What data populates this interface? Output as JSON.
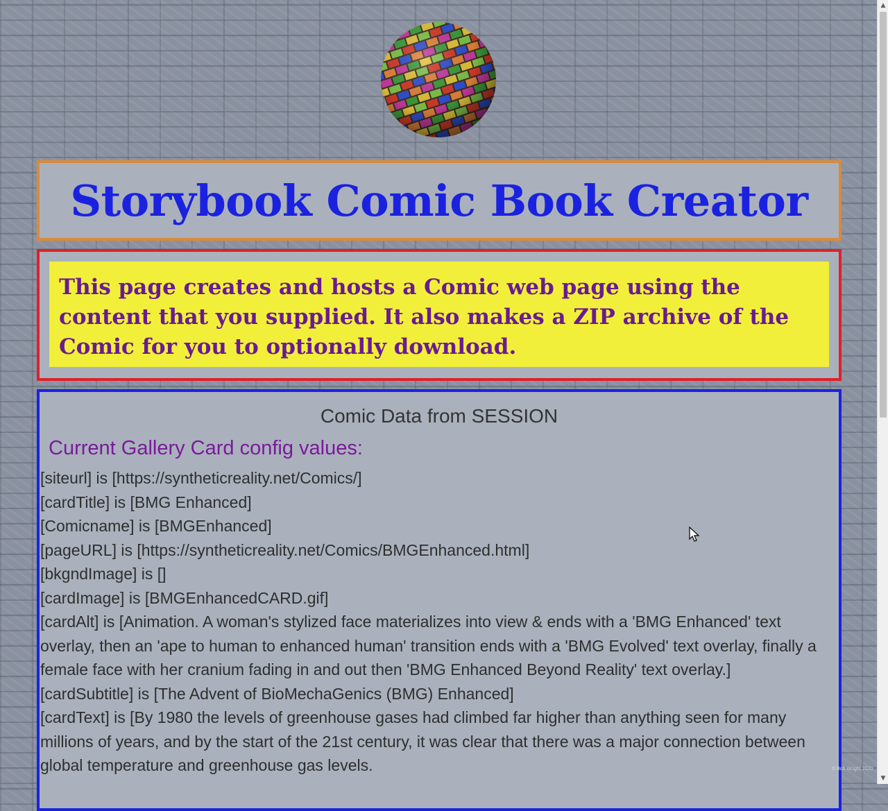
{
  "header": {
    "logo_icon": "checkered-sphere-icon",
    "title": "Storybook Comic Book Creator"
  },
  "intro": {
    "text": "This page creates and hosts a Comic web page using the content that you supplied. It also makes a ZIP archive of the Comic for you to optionally download."
  },
  "session": {
    "heading": "Comic Data from SESSION",
    "subheading": "Current Gallery Card config values:",
    "lines": [
      "[siteurl] is [https://syntheticreality.net/Comics/]",
      "[cardTitle] is [BMG Enhanced]",
      "[Comicname] is [BMGEnhanced]",
      "[pageURL] is [https://syntheticreality.net/Comics/BMGEnhanced.html]",
      "[bkgndImage] is []",
      "[cardImage] is [BMGEnhancedCARD.gif]",
      "[cardAlt] is [Animation. A woman's stylized face materializes into view & ends with a 'BMG Enhanced' text overlay, then an 'ape to human to enhanced human' transition ends with a 'BMG Evolved' text overlay, finally a female face with her cranium fading in and out then 'BMG Enhanced Beyond Reality' text overlay.]",
      "[cardSubtitle] is [The Advent of BioMechaGenics (BMG) Enhanced]",
      "[cardText] is [By 1980 the levels of greenhouse gases had climbed far higher than anything seen for many millions of years, and by the start of the 21st century, it was clear that there was a major connection between global temperature and greenhouse gas levels."
    ]
  },
  "footer": {
    "copyright": "© Bob Wright 2020"
  },
  "colors": {
    "title_text": "#1a22e0",
    "title_border": "#d98a3a",
    "intro_border": "#e0202a",
    "intro_background": "#f2ef3a",
    "intro_text": "#6a1b92",
    "data_border": "#1a22e0",
    "subheading_text": "#7a1a9a"
  }
}
